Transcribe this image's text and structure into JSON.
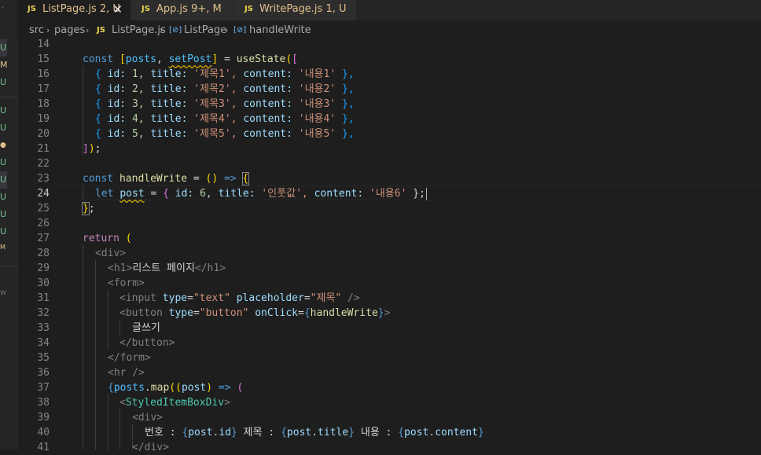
{
  "tabs": [
    {
      "icon": "JS",
      "label": "ListPage.js",
      "status": "2, U",
      "active": true
    },
    {
      "icon": "JS",
      "label": "App.js",
      "status": "9+, M",
      "active": false
    },
    {
      "icon": "JS",
      "label": "WritePage.js",
      "status": "1, U",
      "active": false
    }
  ],
  "close_glyph": "✕",
  "breadcrumb": {
    "src": "src",
    "pages": "pages",
    "file_icon": "JS",
    "file": "ListPage.js",
    "sym_icon": "[⊘]",
    "comp": "ListPage",
    "sym2_icon": "[⊘]",
    "fn": "handleWrite",
    "sep": "›"
  },
  "sidebar_marks": [
    "U",
    "M",
    "U",
    "U",
    "U",
    "●",
    "U",
    "U",
    "U",
    "U",
    "U",
    "M",
    "w"
  ],
  "line_numbers": [
    "14",
    "15",
    "16",
    "17",
    "18",
    "19",
    "20",
    "21",
    "22",
    "23",
    "24",
    "25",
    "26",
    "27",
    "28",
    "29",
    "30",
    "31",
    "32",
    "33",
    "34",
    "35",
    "36",
    "37",
    "38",
    "39",
    "40",
    "41"
  ],
  "current_line": "24",
  "code": {
    "l15": {
      "kw": "const",
      "b1": "[",
      "v1": "posts",
      "c1": ",",
      "v2": "setPost",
      "b2": "]",
      "eq": "=",
      "fn": "useState",
      "b3": "(",
      "b4": "["
    },
    "rows": [
      {
        "open": "{",
        "k1": "id:",
        "n": "1,",
        "k2": "title:",
        "s1": "'제목1',",
        "k3": "content:",
        "s2": "'내용1'",
        "close": "},"
      },
      {
        "open": "{",
        "k1": "id:",
        "n": "2,",
        "k2": "title:",
        "s1": "'제목2',",
        "k3": "content:",
        "s2": "'내용2'",
        "close": "},"
      },
      {
        "open": "{",
        "k1": "id:",
        "n": "3,",
        "k2": "title:",
        "s1": "'제목3',",
        "k3": "content:",
        "s2": "'내용3'",
        "close": "},"
      },
      {
        "open": "{",
        "k1": "id:",
        "n": "4,",
        "k2": "title:",
        "s1": "'제목4',",
        "k3": "content:",
        "s2": "'내용4'",
        "close": "},"
      },
      {
        "open": "{",
        "k1": "id:",
        "n": "5,",
        "k2": "title:",
        "s1": "'제목5',",
        "k3": "content:",
        "s2": "'내용5'",
        "close": "},"
      }
    ],
    "l21": {
      "b1": "]",
      "b2": ")",
      "semi": ";"
    },
    "l23": {
      "kw": "const",
      "fn": "handleWrite",
      "eq": "=",
      "par": "()",
      "arrow": "=>",
      "brace": "{"
    },
    "l24": {
      "kw": "let",
      "v": "post",
      "eq": "=",
      "o": "{",
      "k1": "id:",
      "n": "6,",
      "k2": "title:",
      "s1": "'인풋값',",
      "k3": "content:",
      "s2": "'내용6'",
      "c": "};"
    },
    "l25": {
      "brace": "}",
      "semi": ";"
    },
    "l27": {
      "kw": "return",
      "par": "("
    },
    "l28": {
      "tag": "<div>"
    },
    "l29": {
      "open": "<h1>",
      "text": "리스트 페이지",
      "close": "</h1>"
    },
    "l30": {
      "tag": "<form>"
    },
    "l31": {
      "open": "<input",
      "a1": "type",
      "eq1": "=",
      "v1": "\"text\"",
      "a2": "placeholder",
      "eq2": "=",
      "v2": "\"제목\"",
      "close": "/>"
    },
    "l32": {
      "open": "<button",
      "a1": "type",
      "eq1": "=",
      "v1": "\"button\"",
      "a2": "onClick",
      "eq2": "=",
      "b1": "{",
      "fn": "handleWrite",
      "b2": "}",
      "close": ">"
    },
    "l33": {
      "text": "글쓰기"
    },
    "l34": {
      "tag": "</button>"
    },
    "l35": {
      "tag": "</form>"
    },
    "l36": {
      "tag": "<hr />"
    },
    "l37": {
      "b1": "{",
      "v": "posts",
      "dot": ".",
      "fn": "map",
      "p1": "((",
      "arg": "post",
      "p2": ")",
      "arrow": "=>",
      "p3": "("
    },
    "l38": {
      "lt": "<",
      "tag": "StyledItemBoxDiv",
      "gt": ">"
    },
    "l39": {
      "tag": "<div>"
    },
    "l40": {
      "t1": "번호 : ",
      "b1": "{",
      "e1": "post.id",
      "b2": "}",
      "t2": " 제목 : ",
      "b3": "{",
      "e2": "post.title",
      "b4": "}",
      "t3": " 내용 : ",
      "b5": "{",
      "e3": "post.content",
      "b6": "}"
    },
    "l41": {
      "tag": "</div>"
    }
  }
}
